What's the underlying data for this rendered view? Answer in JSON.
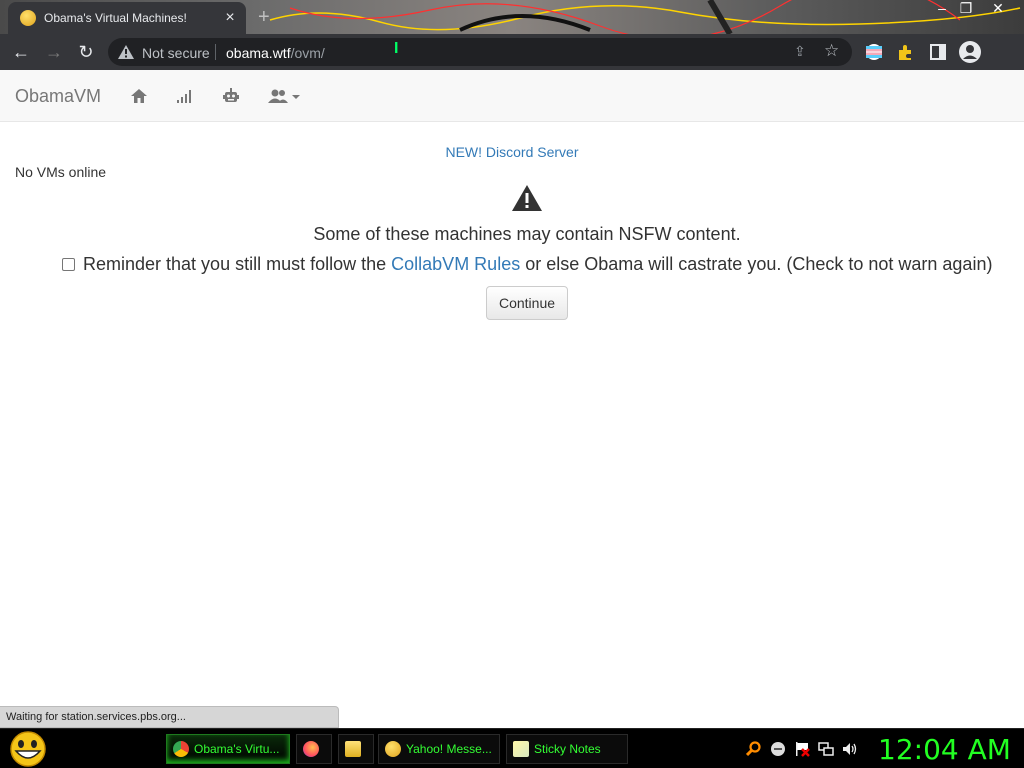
{
  "browser": {
    "tab_title": "Obama's Virtual Machines!",
    "tab_close": "×",
    "new_tab": "+",
    "window_controls": [
      "–",
      "❐",
      "✕"
    ],
    "security_label": "Not secure",
    "url_host": "obama.wtf",
    "url_path": "/ovm/",
    "icons": [
      "back-icon",
      "forward-icon",
      "reload-icon",
      "warning-icon",
      "share-icon",
      "star-icon",
      "profile-flag-icon",
      "extensions-icon",
      "side-panel-icon",
      "account-icon"
    ]
  },
  "site": {
    "brand": "ObamaVM",
    "nav_icons": [
      "home-icon",
      "signal-icon",
      "robot-icon",
      "users-icon"
    ],
    "discord_link": "NEW! Discord Server",
    "vm_status": "No VMs online",
    "warning_text": "Some of these machines may contain NSFW content.",
    "reminder_before": "Reminder that you still must follow the ",
    "reminder_link": "CollabVM Rules",
    "reminder_after": " or else Obama will castrate you. (Check to not warn again)",
    "continue_label": "Continue"
  },
  "status_bar": "Waiting for station.services.pbs.org...",
  "taskbar": {
    "buttons": [
      {
        "label": "Obama's Virtu...",
        "icon": "chrome-icon",
        "active": true
      },
      {
        "label": "",
        "icon": "firefox-icon",
        "active": false
      },
      {
        "label": "",
        "icon": "folder-icon",
        "active": false
      },
      {
        "label": "Yahoo! Messe...",
        "icon": "yahoo-messenger-icon",
        "active": false
      },
      {
        "label": "Sticky Notes",
        "icon": "sticky-notes-icon",
        "active": false
      }
    ],
    "tray_icons": [
      "search-icon",
      "smiley-icon",
      "flag-icon",
      "network-icon",
      "volume-icon"
    ],
    "clock": "12:04 AM"
  },
  "colors": {
    "link": "#337ab7",
    "clock": "#22ff22",
    "taskbar_label": "#33ff33",
    "browser_frame": "#35363a"
  }
}
